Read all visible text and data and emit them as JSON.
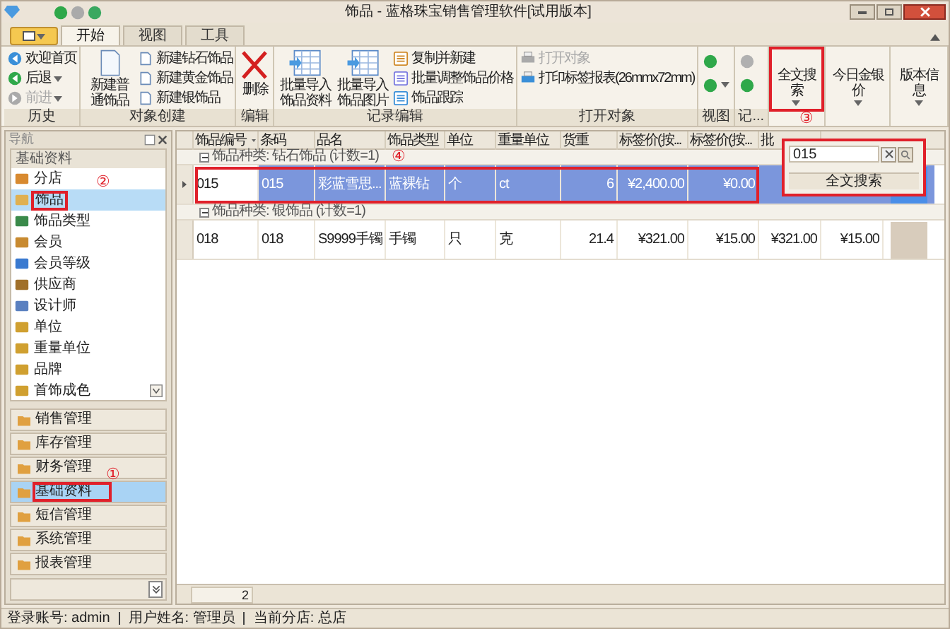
{
  "window": {
    "title": "饰品 - 蓝格珠宝销售管理软件[试用版本]"
  },
  "tabs": [
    {
      "label": "开始",
      "selected": true
    },
    {
      "label": "视图",
      "selected": false
    },
    {
      "label": "工具",
      "selected": false
    }
  ],
  "ribbon": {
    "groups": [
      {
        "title": "历史",
        "columns": [
          [
            {
              "kind": "small",
              "label": "欢迎首页",
              "disabled": false,
              "dropdown": false
            },
            {
              "kind": "small",
              "label": "后退",
              "disabled": false,
              "dropdown": true
            },
            {
              "kind": "small",
              "label": "前进",
              "disabled": true,
              "dropdown": true
            }
          ]
        ]
      },
      {
        "title": "对象创建",
        "columns": [
          [
            {
              "kind": "large",
              "label": "新建普通饰品",
              "disabled": false,
              "dropdown": false
            }
          ],
          [
            {
              "kind": "small",
              "label": "新建钻石饰品",
              "disabled": false,
              "dropdown": false
            },
            {
              "kind": "small",
              "label": "新建黄金饰品",
              "disabled": false,
              "dropdown": false
            },
            {
              "kind": "small",
              "label": "新建银饰品",
              "disabled": false,
              "dropdown": false
            }
          ]
        ]
      },
      {
        "title": "编辑",
        "columns": [
          [
            {
              "kind": "large",
              "label": "删除",
              "disabled": false,
              "dropdown": false
            }
          ]
        ]
      },
      {
        "title": "记录编辑",
        "columns": [
          [
            {
              "kind": "large",
              "label": "批量导入饰品资料",
              "disabled": false,
              "dropdown": false
            }
          ],
          [
            {
              "kind": "large",
              "label": "批量导入饰品图片",
              "disabled": false,
              "dropdown": false
            }
          ],
          [
            {
              "kind": "small",
              "label": "复制并新建",
              "disabled": false,
              "dropdown": false
            },
            {
              "kind": "small",
              "label": "批量调整饰品价格",
              "disabled": false,
              "dropdown": false
            },
            {
              "kind": "small",
              "label": "饰品跟踪",
              "disabled": false,
              "dropdown": false
            }
          ]
        ]
      },
      {
        "title": "打开对象",
        "columns": [
          [
            {
              "kind": "small",
              "label": "打开对象",
              "disabled": true,
              "dropdown": false
            },
            {
              "kind": "small",
              "label": "打印标签报表(26mmx72mm)",
              "disabled": false,
              "dropdown": false
            }
          ]
        ]
      },
      {
        "title": "视图",
        "columns": [
          [
            {
              "kind": "icon",
              "disabled": false,
              "dropdown": false
            },
            {
              "kind": "icon",
              "disabled": false,
              "dropdown": true
            }
          ]
        ]
      },
      {
        "title": "记...",
        "columns": [
          [
            {
              "kind": "icon",
              "disabled": true,
              "dropdown": false
            },
            {
              "kind": "icon",
              "disabled": false,
              "dropdown": false
            }
          ]
        ]
      },
      {
        "columns": [
          [
            {
              "kind": "large",
              "label": "全文搜索",
              "disabled": false,
              "dropdown": true,
              "marker": "③"
            }
          ]
        ]
      },
      {
        "columns": [
          [
            {
              "kind": "large",
              "label": "今日金银价",
              "disabled": false,
              "dropdown": true
            }
          ]
        ]
      },
      {
        "columns": [
          [
            {
              "kind": "large",
              "label": "版本信息",
              "disabled": false,
              "dropdown": true
            }
          ]
        ]
      }
    ]
  },
  "sidebar": {
    "title": "导航",
    "panel_title": "基础资料",
    "items": [
      {
        "label": "分店",
        "selected": false
      },
      {
        "label": "饰品",
        "selected": true,
        "marker": "②"
      },
      {
        "label": "饰品类型",
        "selected": false
      },
      {
        "label": "会员",
        "selected": false
      },
      {
        "label": "会员等级",
        "selected": false
      },
      {
        "label": "供应商",
        "selected": false
      },
      {
        "label": "设计师",
        "selected": false
      },
      {
        "label": "单位",
        "selected": false
      },
      {
        "label": "重量单位",
        "selected": false
      },
      {
        "label": "品牌",
        "selected": false
      },
      {
        "label": "首饰成色",
        "selected": false
      }
    ],
    "groups": [
      {
        "label": "销售管理",
        "selected": false
      },
      {
        "label": "库存管理",
        "selected": false
      },
      {
        "label": "财务管理",
        "selected": false
      },
      {
        "label": "基础资料",
        "selected": true,
        "marker": "①"
      },
      {
        "label": "短信管理",
        "selected": false
      },
      {
        "label": "系统管理",
        "selected": false
      },
      {
        "label": "报表管理",
        "selected": false
      }
    ]
  },
  "table": {
    "columns": [
      "饰品编号",
      "条码",
      "品名",
      "饰品类型",
      "单位",
      "重量单位",
      "货重",
      "标签价(按...",
      "标签价(按...",
      "批"
    ],
    "groups": [
      {
        "label": "饰品种类: 钻石饰品 (计数=1)",
        "expanded": true,
        "marker": "④",
        "rows": [
          {
            "selected": true,
            "current": true,
            "cells": [
              "015",
              "015",
              "彩蓝雪思...",
              "蓝裸钻",
              "个",
              "ct",
              "6",
              "¥2,400.00",
              "¥0.00"
            ]
          }
        ]
      },
      {
        "label": "饰品种类: 银饰品 (计数=1)",
        "expanded": true,
        "rows": [
          {
            "selected": false,
            "current": false,
            "cells": [
              "018",
              "018",
              "S9999手镯",
              "手镯",
              "只",
              "克",
              "21.4",
              "¥321.00",
              "¥15.00",
              "¥321.00",
              "¥15.00"
            ]
          }
        ]
      }
    ],
    "footer_count": "2"
  },
  "search_popup": {
    "value": "015",
    "button": "全文搜索",
    "highlighted": true
  },
  "status_bar": [
    "登录账号: admin",
    "用户姓名: 管理员",
    "当前分店: 总店"
  ]
}
